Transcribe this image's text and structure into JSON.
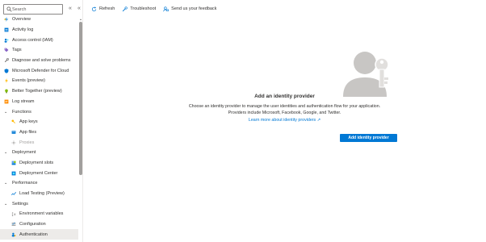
{
  "search": {
    "placeholder": "Search"
  },
  "sidebar": {
    "collapse_label": "«",
    "collapse2_label": "«",
    "items": [
      {
        "label": "Overview",
        "icon": "lightning-icon"
      },
      {
        "label": "Activity log",
        "icon": "activity-log-icon"
      },
      {
        "label": "Access control (IAM)",
        "icon": "iam-icon"
      },
      {
        "label": "Tags",
        "icon": "tag-icon"
      },
      {
        "label": "Diagnose and solve problems",
        "icon": "wrench-icon"
      },
      {
        "label": "Microsoft Defender for Cloud",
        "icon": "shield-icon"
      },
      {
        "label": "Events (preview)",
        "icon": "events-icon"
      },
      {
        "label": "Better Together (preview)",
        "icon": "lightbulb-icon"
      },
      {
        "label": "Log stream",
        "icon": "log-stream-icon"
      }
    ],
    "groups": [
      {
        "label": "Functions",
        "items": [
          {
            "label": "App keys",
            "icon": "key-icon"
          },
          {
            "label": "App files",
            "icon": "files-icon"
          },
          {
            "label": "Proxies",
            "icon": "proxies-icon"
          }
        ]
      },
      {
        "label": "Deployment",
        "items": [
          {
            "label": "Deployment slots",
            "icon": "slots-icon"
          },
          {
            "label": "Deployment Center",
            "icon": "deployment-center-icon"
          }
        ]
      },
      {
        "label": "Performance",
        "items": [
          {
            "label": "Load Testing (Preview)",
            "icon": "load-testing-icon"
          }
        ]
      },
      {
        "label": "Settings",
        "items": [
          {
            "label": "Environment variables",
            "icon": "variables-icon"
          },
          {
            "label": "Configuration",
            "icon": "configuration-icon"
          },
          {
            "label": "Authentication",
            "icon": "authentication-icon"
          }
        ]
      }
    ]
  },
  "toolbar": {
    "refresh": "Refresh",
    "troubleshoot": "Troubleshoot",
    "feedback": "Send us your feedback"
  },
  "main": {
    "title": "Add an identity provider",
    "desc_line1": "Choose an identity provider to manage the user identities and authentication flow for your application.",
    "desc_line2": "Providers include Microsoft, Facebook, Google, and Twitter.",
    "learn_more": "Learn more about identity providers ↗",
    "button": "Add identity provider"
  },
  "colors": {
    "accent": "#0078d4",
    "active_bg": "#edebe9"
  }
}
